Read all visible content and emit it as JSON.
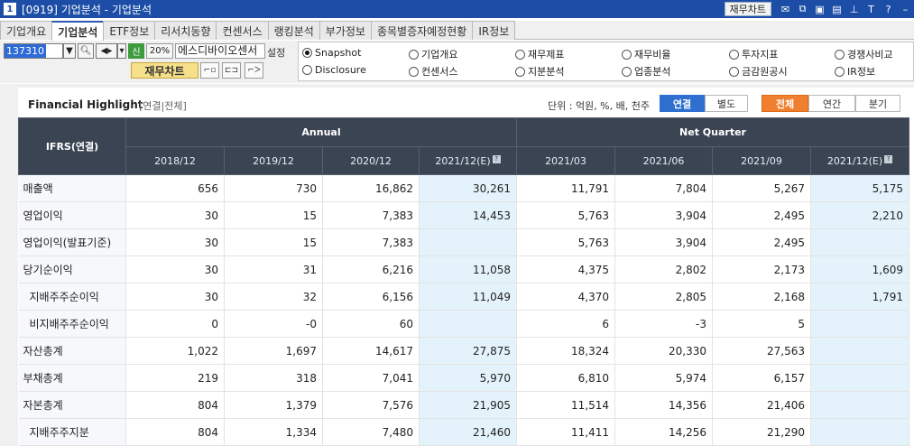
{
  "window": {
    "number": "1",
    "title": "[0919] 기업분석 - 기업분석",
    "financial_chart_button": "재무차트"
  },
  "tabs": [
    {
      "label": "기업개요"
    },
    {
      "label": "기업분석"
    },
    {
      "label": "ETF정보"
    },
    {
      "label": "리서치동향"
    },
    {
      "label": "컨센서스"
    },
    {
      "label": "랭킹분석"
    },
    {
      "label": "부가정보"
    },
    {
      "label": "종목별증자예정현황"
    },
    {
      "label": "IR정보"
    }
  ],
  "controls": {
    "stock_code": "137310",
    "credit_badge": "신",
    "margin_rate": "20%",
    "stock_name": "에스디바이오센서",
    "settings_label": "설정",
    "financial_chart_label": "재무차트"
  },
  "radio_options": [
    {
      "label": "Snapshot",
      "selected": true
    },
    {
      "label": "기업개요",
      "selected": false
    },
    {
      "label": "재무제표",
      "selected": false
    },
    {
      "label": "재무비율",
      "selected": false
    },
    {
      "label": "투자지표",
      "selected": false
    },
    {
      "label": "경쟁사비교",
      "selected": false
    },
    {
      "label": "Disclosure",
      "selected": false
    },
    {
      "label": "컨센서스",
      "selected": false
    },
    {
      "label": "지분분석",
      "selected": false
    },
    {
      "label": "업종분석",
      "selected": false
    },
    {
      "label": "금감원공시",
      "selected": false
    },
    {
      "label": "IR정보",
      "selected": false
    }
  ],
  "highlight": {
    "title": "Financial Highlight",
    "subtitle": "[연결|전체]",
    "unit": "단위 : 억원, %, 배, 천주",
    "toggle_consolidated": "연결",
    "toggle_separate": "별도",
    "toggle_all": "전체",
    "toggle_annual": "연간",
    "toggle_quarter": "분기",
    "row_header": "IFRS(연결)",
    "annual_header": "Annual",
    "quarter_header": "Net Quarter",
    "annual_years": [
      "2018/12",
      "2019/12",
      "2020/12",
      "2021/12(E)"
    ],
    "quarter_periods": [
      "2021/03",
      "2021/06",
      "2021/09",
      "2021/12(E)"
    ],
    "rows": [
      {
        "label": "매출액",
        "values": [
          "656",
          "730",
          "16,862",
          "30,261",
          "11,791",
          "7,804",
          "5,267",
          "5,175"
        ]
      },
      {
        "label": "영업이익",
        "values": [
          "30",
          "15",
          "7,383",
          "14,453",
          "5,763",
          "3,904",
          "2,495",
          "2,210"
        ]
      },
      {
        "label": "영업이익(발표기준)",
        "values": [
          "30",
          "15",
          "7,383",
          "",
          "5,763",
          "3,904",
          "2,495",
          ""
        ]
      },
      {
        "label": "당기순이익",
        "values": [
          "30",
          "31",
          "6,216",
          "11,058",
          "4,375",
          "2,802",
          "2,173",
          "1,609"
        ]
      },
      {
        "label": "지배주주순이익",
        "values": [
          "30",
          "32",
          "6,156",
          "11,049",
          "4,370",
          "2,805",
          "2,168",
          "1,791"
        ]
      },
      {
        "label": "비지배주주순이익",
        "values": [
          "0",
          "-0",
          "60",
          "",
          "6",
          "-3",
          "5",
          ""
        ]
      },
      {
        "label": "자산총계",
        "values": [
          "1,022",
          "1,697",
          "14,617",
          "27,875",
          "18,324",
          "20,330",
          "27,563",
          ""
        ]
      },
      {
        "label": "부채총계",
        "values": [
          "219",
          "318",
          "7,041",
          "5,970",
          "6,810",
          "5,974",
          "6,157",
          ""
        ]
      },
      {
        "label": "자본총계",
        "values": [
          "804",
          "1,379",
          "7,576",
          "21,905",
          "11,514",
          "14,356",
          "21,406",
          ""
        ]
      },
      {
        "label": "지배주주지분",
        "values": [
          "804",
          "1,334",
          "7,480",
          "21,460",
          "11,411",
          "14,256",
          "21,290",
          ""
        ]
      }
    ]
  },
  "colors": {
    "titlebar": "#1c4ea7",
    "header_bg": "#3b4452",
    "estimate_bg": "#e4f3fb",
    "toggle_blue": "#2e6fd0",
    "toggle_orange": "#f07f2f",
    "negative": "#d02020"
  }
}
